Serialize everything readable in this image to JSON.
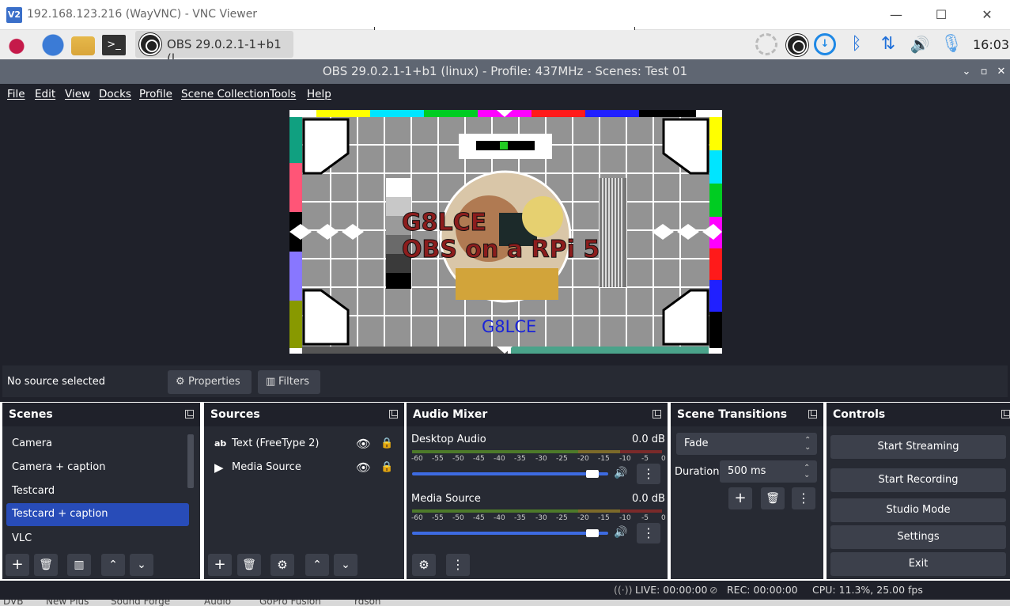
{
  "vnc": {
    "title": "192.168.123.216 (WayVNC) - VNC Viewer",
    "logo": "V2",
    "minimize": "—",
    "maximize": "☐",
    "close": "✕"
  },
  "taskbar": {
    "app_button": "OBS 29.0.2.1-1+b1 (l...",
    "clock": "16:03",
    "icons": [
      "raspberry-menu-icon",
      "web-browser-icon",
      "file-manager-icon",
      "terminal-icon",
      "network-icon",
      "obs-icon",
      "download-icon",
      "bluetooth-icon",
      "data-transfer-icon",
      "volume-icon",
      "microphone-icon"
    ]
  },
  "obs_title": {
    "text": "OBS 29.0.2.1-1+b1 (linux) - Profile: 437MHz - Scenes: Test 01"
  },
  "menu": {
    "file": "File",
    "edit": "Edit",
    "view": "View",
    "docks": "Docks",
    "profile": "Profile",
    "scene_collection": "Scene Collection",
    "tools": "Tools",
    "help": "Help"
  },
  "preview": {
    "caption_line1": "G8LCE",
    "caption_line2": "OBS on a RPi 5",
    "footer": "G8LCE"
  },
  "source_bar": {
    "status": "No source selected",
    "properties": "Properties",
    "filters": "Filters"
  },
  "scenes": {
    "title": "Scenes",
    "items": [
      "Camera",
      "Camera + caption",
      "Testcard",
      "Testcard + caption",
      "VLC"
    ],
    "selected": 3
  },
  "sources": {
    "title": "Sources",
    "items": [
      "Text (FreeType 2)",
      "Media Source"
    ]
  },
  "audio": {
    "title": "Audio Mixer",
    "channels": [
      {
        "name": "Desktop Audio",
        "db": "0.0 dB",
        "level": 0.92
      },
      {
        "name": "Media Source",
        "db": "0.0 dB",
        "level": 0.92
      }
    ],
    "ticks": [
      "-60",
      "-55",
      "-50",
      "-45",
      "-40",
      "-35",
      "-30",
      "-25",
      "-20",
      "-15",
      "-10",
      "-5",
      "0"
    ]
  },
  "transitions": {
    "title": "Scene Transitions",
    "type": "Fade",
    "duration_label": "Duration",
    "duration": "500 ms"
  },
  "controls": {
    "title": "Controls",
    "start_streaming": "Start Streaming",
    "start_recording": "Start Recording",
    "studio_mode": "Studio Mode",
    "settings": "Settings",
    "exit": "Exit"
  },
  "status": {
    "live": "LIVE: 00:00:00",
    "rec": "REC: 00:00:00",
    "cpu": "CPU: 11.3%, 25.00 fps"
  },
  "bottom_strip": [
    "DVB",
    "New Plus",
    "Sound Forge",
    "Audio",
    "GoPro Fusion",
    "rdson"
  ]
}
